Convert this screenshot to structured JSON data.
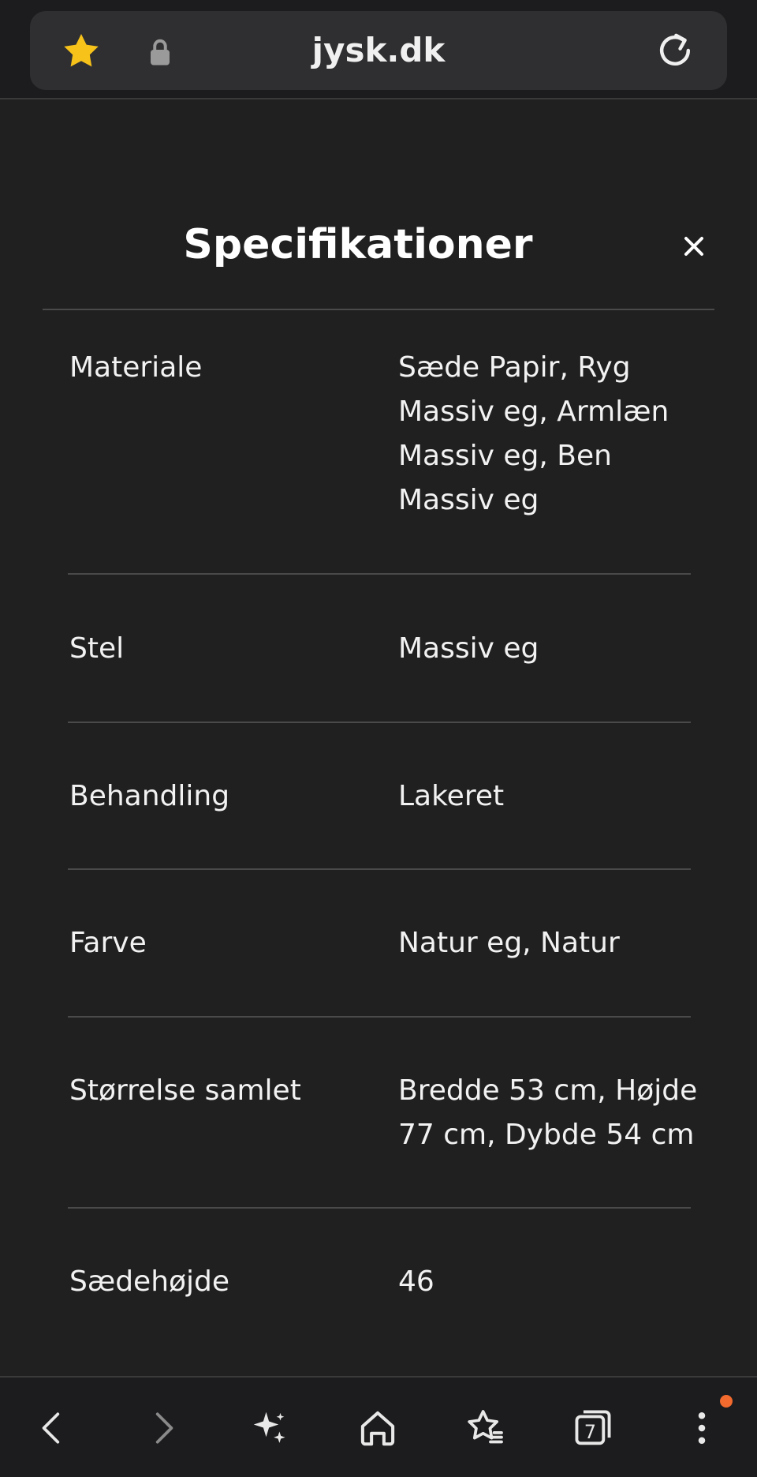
{
  "browser": {
    "domain": "jysk.dk",
    "icons": {
      "favorite": "star-icon",
      "security": "lock-icon",
      "reload": "reload-icon"
    },
    "colors": {
      "star": "#f7c21a",
      "notification": "#f26a2e"
    }
  },
  "modal": {
    "title": "Specifikationer",
    "close_icon": "close-icon",
    "specs": [
      {
        "label": "Materiale",
        "value": "Sæde Papir, Ryg Massiv eg, Armlæn Massiv eg, Ben Massiv eg"
      },
      {
        "label": "Stel",
        "value": "Massiv eg"
      },
      {
        "label": "Behandling",
        "value": "Lakeret"
      },
      {
        "label": "Farve",
        "value": "Natur eg, Natur"
      },
      {
        "label": "Størrelse samlet",
        "value": "Bredde 53 cm, Højde 77 cm, Dybde 54 cm"
      },
      {
        "label": "Sædehøjde",
        "value": "46"
      }
    ]
  },
  "bottom_nav": {
    "tab_count": "7",
    "icons": [
      "back-icon",
      "forward-icon",
      "sparkle-icon",
      "home-icon",
      "bookmarks-icon",
      "tabs-icon",
      "more-icon"
    ]
  }
}
